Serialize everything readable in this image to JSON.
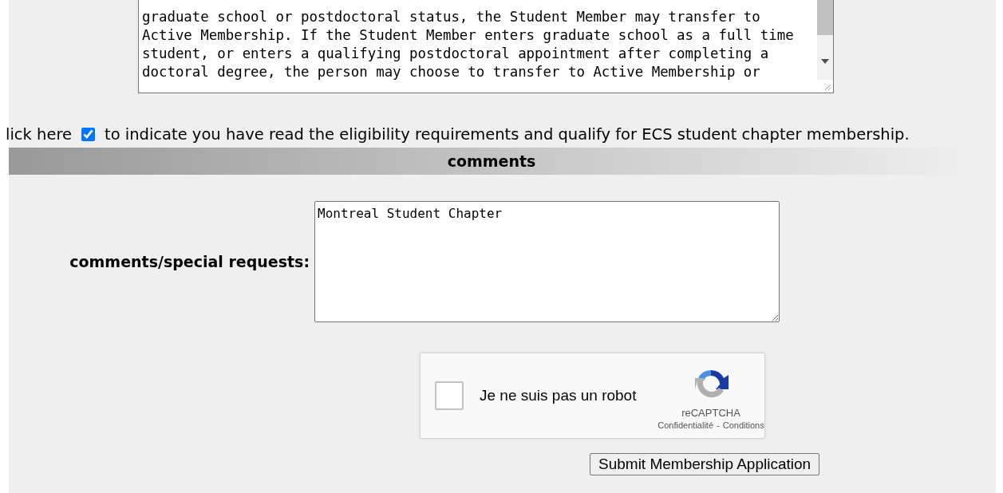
{
  "eligibility_text": {
    "lines": [
      "graduate school or postdoctoral status, the Student Member may transfer to",
      "Active Membership. If the Student Member enters graduate school as a full time",
      "student, or enters a qualifying postdoctoral appointment after completing a",
      "doctoral degree, the person may choose to transfer to Active Membership or"
    ]
  },
  "agreement": {
    "before": "lick here",
    "checked": true,
    "after": "to indicate you have read the eligibility requirements and qualify for ECS student chapter membership."
  },
  "section_header": "comments",
  "comments": {
    "label": "comments/special requests:",
    "value": "Montreal Student Chapter"
  },
  "captcha": {
    "checked": false,
    "label": "Je ne suis pas un robot",
    "brand": "reCAPTCHA",
    "privacy": "Confidentialité",
    "separator": "-",
    "terms": "Conditions"
  },
  "submit_button": "Submit Membership Application"
}
